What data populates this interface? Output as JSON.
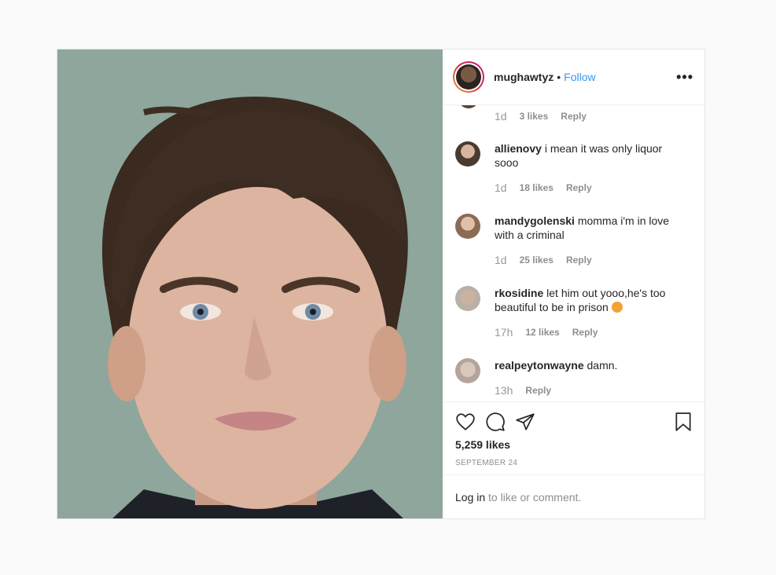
{
  "post": {
    "username": "mughawtyz",
    "separator": "•",
    "follow_label": "Follow",
    "more_label": "•••"
  },
  "top_comment_meta": {
    "time": "1d",
    "likes": "3 likes",
    "reply": "Reply"
  },
  "comments": [
    {
      "user": "allienovy",
      "text": "i mean it was only liquor sooo",
      "time": "1d",
      "likes": "18 likes",
      "reply": "Reply"
    },
    {
      "user": "mandygolenski",
      "text": "momma i'm in love with a criminal",
      "time": "1d",
      "likes": "25 likes",
      "reply": "Reply"
    },
    {
      "user": "rkosidine",
      "text": "let him out yooo,he's too beautiful to be in prison",
      "time": "17h",
      "likes": "12 likes",
      "reply": "Reply"
    },
    {
      "user": "realpeytonwayne",
      "text": "damn.",
      "time": "13h",
      "likes": "",
      "reply": "Reply"
    }
  ],
  "icons": {
    "like": "heart-icon",
    "comment": "comment-icon",
    "share": "share-icon",
    "save": "bookmark-icon",
    "emoji": "emoji-icon"
  },
  "likes_total": "5,259 likes",
  "date": "SEPTEMBER 24",
  "login": {
    "link": "Log in",
    "rest": " to like or comment."
  },
  "colors": {
    "link": "#3897f0",
    "muted": "#8e8e8e",
    "text": "#262626",
    "photo_bg": "#8fa79d"
  }
}
